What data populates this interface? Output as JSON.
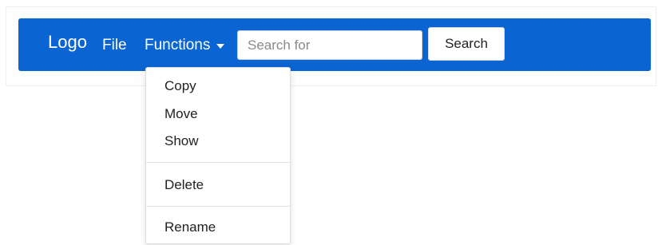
{
  "navbar": {
    "logo": "Logo",
    "file": "File",
    "functions": "Functions",
    "search": {
      "placeholder": "Search for",
      "value": ""
    },
    "search_button": "Search",
    "colors": {
      "background": "#0a64d2",
      "text": "#ffffff"
    }
  },
  "functions_menu": {
    "open": true,
    "items": [
      "Copy",
      "Move",
      "Show",
      "Delete",
      "Rename"
    ]
  }
}
